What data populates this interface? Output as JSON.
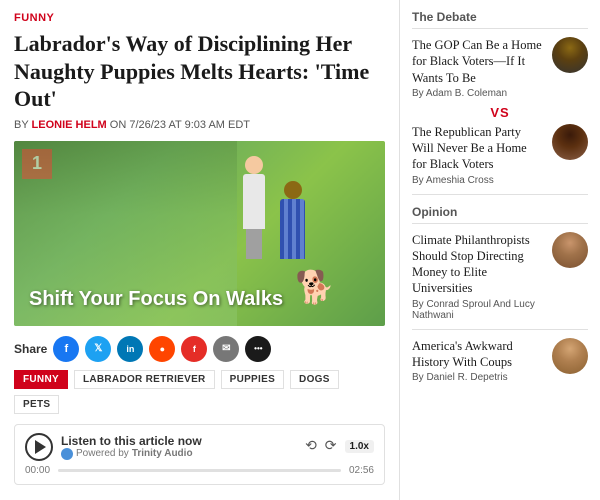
{
  "left": {
    "category": "FUNNY",
    "title": "Labrador's Way of Disciplining Her Naughty Puppies Melts Hearts: 'Time Out'",
    "byline_prefix": "BY",
    "author": "LEONIE HELM",
    "date": "ON 7/26/23 AT 9:03 AM EDT",
    "image_badge": "1",
    "image_overlay": "Shift Your Focus On Walks",
    "share_label": "Share",
    "social_buttons": [
      {
        "name": "facebook",
        "class": "fb",
        "label": "f"
      },
      {
        "name": "twitter",
        "class": "tw",
        "label": "t"
      },
      {
        "name": "linkedin",
        "class": "li",
        "label": "in"
      },
      {
        "name": "reddit",
        "class": "rd",
        "label": "r"
      },
      {
        "name": "flipboard",
        "class": "fp",
        "label": "f"
      },
      {
        "name": "email",
        "class": "em",
        "label": "✉"
      },
      {
        "name": "more",
        "class": "more",
        "label": "•••"
      }
    ],
    "tags": [
      "FUNNY",
      "LABRADOR RETRIEVER",
      "PUPPIES",
      "DOGS",
      "PETS"
    ],
    "audio": {
      "title": "Listen to this article now",
      "powered_by": "Powered by",
      "provider": "Trinity Audio",
      "time_start": "00:00",
      "time_end": "02:56",
      "speed": "1.0x"
    }
  },
  "right": {
    "debate_section": "The Debate",
    "debate_items": [
      {
        "text": "The GOP Can Be a Home for Black Voters—If It Wants To Be",
        "author": "By Adam B. Coleman"
      },
      {
        "text": "The Republican Party Will Never Be a Home for Black Voters",
        "author": "By Ameshia Cross"
      }
    ],
    "vs_label": "VS",
    "opinion_section": "Opinion",
    "opinion_items": [
      {
        "text": "Climate Philanthropists Should Stop Directing Money to Elite Universities",
        "author": "By Conrad Sproul And Lucy Nathwani"
      },
      {
        "text": "America's Awkward History With Coups",
        "author": "By Daniel R. Depetris"
      }
    ]
  }
}
